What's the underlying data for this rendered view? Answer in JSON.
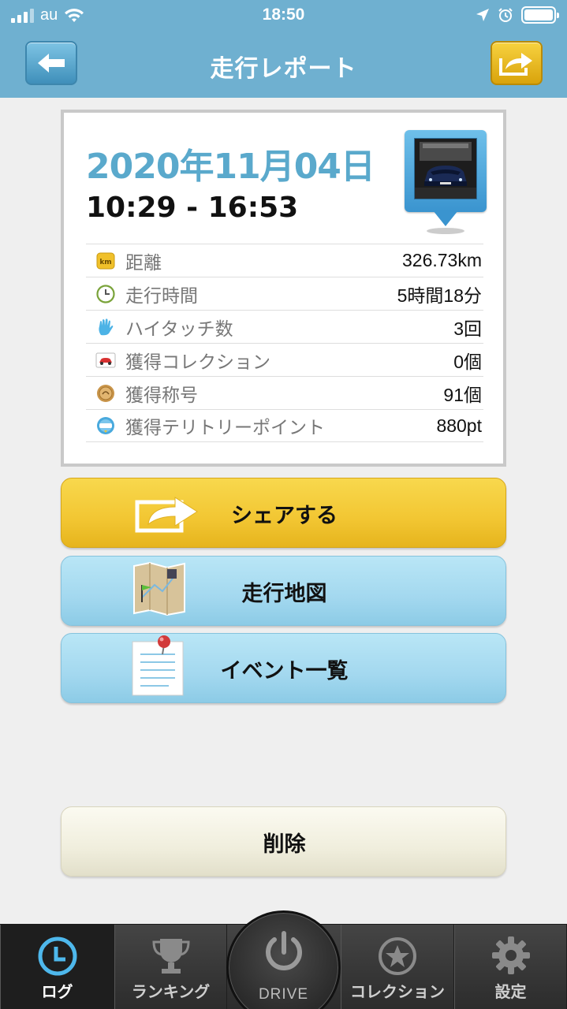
{
  "status_bar": {
    "carrier": "au",
    "time": "18:50"
  },
  "header": {
    "title": "走行レポート",
    "back_icon": "arrow-left-icon",
    "share_icon": "share-arrow-icon",
    "back_color": "#4a9cc7",
    "share_color": "#e9b51c"
  },
  "report": {
    "date": "2020年11月04日",
    "time_range": "10:29 - 16:53",
    "stats": [
      {
        "icon": "km-icon",
        "label": "距離",
        "value": "326.73km"
      },
      {
        "icon": "clock-icon",
        "label": "走行時間",
        "value": "5時間18分"
      },
      {
        "icon": "hand-icon",
        "label": "ハイタッチ数",
        "value": "3回"
      },
      {
        "icon": "car-card-icon",
        "label": "獲得コレクション",
        "value": "0個"
      },
      {
        "icon": "medal-icon",
        "label": "獲得称号",
        "value": "91個"
      },
      {
        "icon": "spot-icon",
        "label": "獲得テリトリーポイント",
        "value": "880pt"
      }
    ]
  },
  "actions": {
    "share": "シェアする",
    "map": "走行地図",
    "events": "イベント一覧",
    "delete": "削除"
  },
  "tabbar": {
    "tabs": [
      {
        "label": "ログ",
        "icon": "clock-icon",
        "active": true
      },
      {
        "label": "ランキング",
        "icon": "trophy-icon",
        "active": false
      },
      {
        "label": "DRIVE",
        "icon": "power-icon",
        "active": false
      },
      {
        "label": "コレクション",
        "icon": "star-icon",
        "active": false
      },
      {
        "label": "設定",
        "icon": "gear-icon",
        "active": false
      }
    ]
  },
  "colors": {
    "header_bg": "#6fb0d0",
    "date_text": "#5aa9cc",
    "share_button": "#f2c632",
    "map_button": "#a3d8ef",
    "delete_button": "#f0eedd",
    "tabbar_bg": "#3a3a3a"
  }
}
